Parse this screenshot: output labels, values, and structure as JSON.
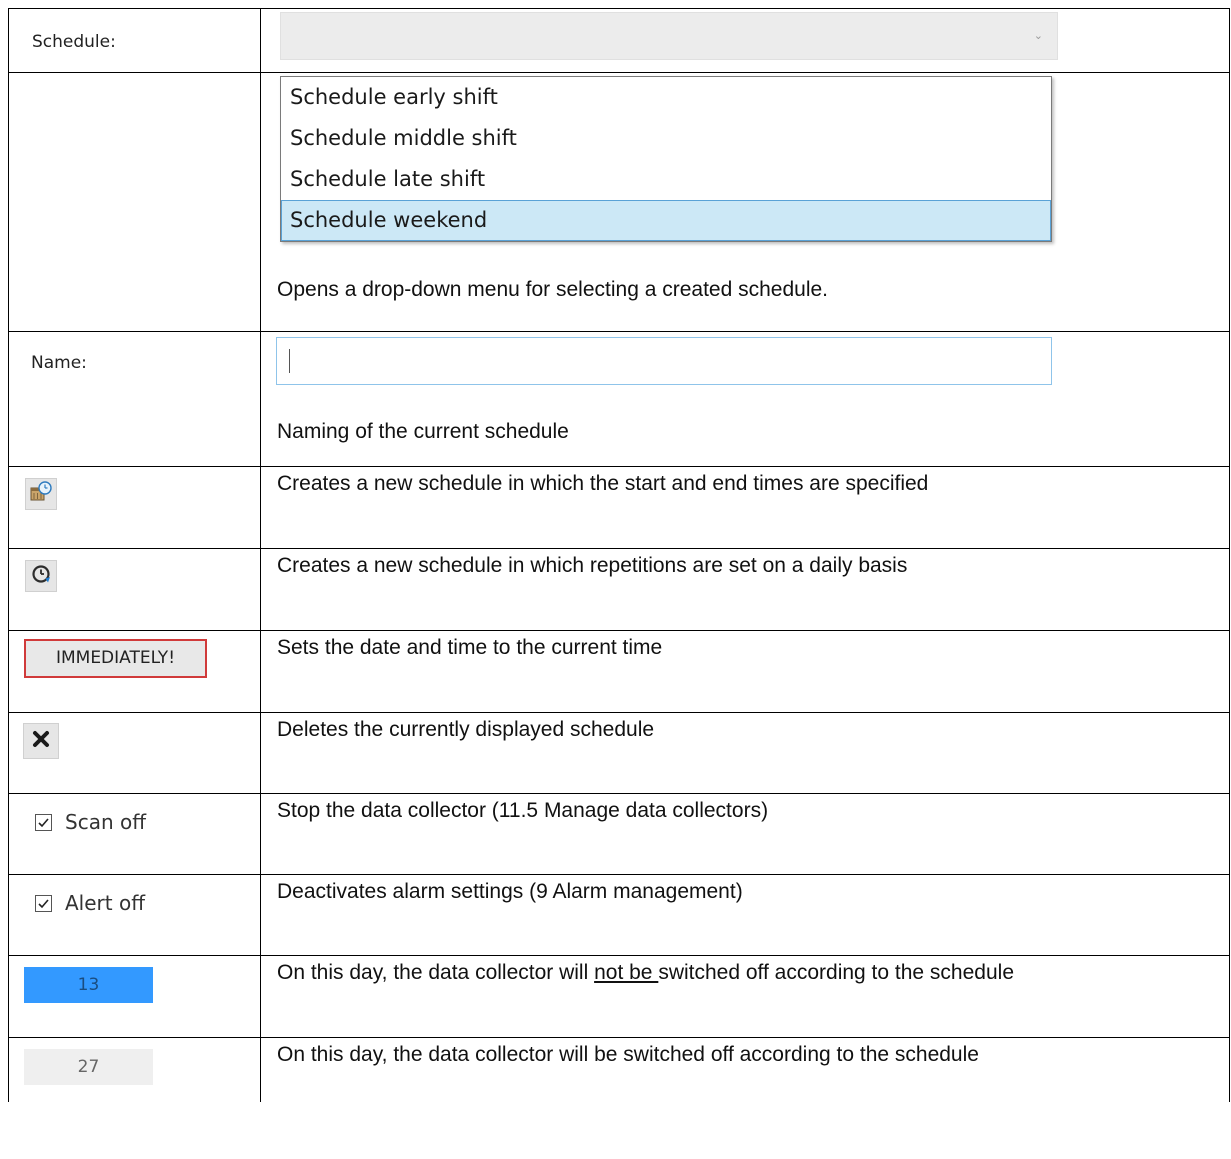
{
  "schedule_row": {
    "label": "Schedule:",
    "combo_value": ""
  },
  "dropdown_row": {
    "options": [
      "Schedule early shift",
      "Schedule middle shift",
      "Schedule late shift",
      "Schedule weekend"
    ],
    "selected_index": 3,
    "description": "Opens a drop-down menu for selecting a created schedule."
  },
  "name_row": {
    "label": "Name:",
    "input_value": "",
    "description": "Naming of the current schedule"
  },
  "new_time_schedule_row": {
    "icon": "calendar-clock-icon",
    "description": "Creates a new schedule in which the start and end times are specified"
  },
  "new_repeat_schedule_row": {
    "icon": "repeat-clock-icon",
    "description": "Creates a new schedule in which repetitions are set on a daily basis"
  },
  "immediately_row": {
    "button_label": "IMMEDIATELY!",
    "description": "Sets the date and time to the current time"
  },
  "delete_row": {
    "icon": "close-icon",
    "description": "Deletes the currently displayed schedule"
  },
  "scan_off_row": {
    "checkbox_label": "Scan off",
    "checked": true,
    "description": "Stop the data collector (11.5 Manage data collectors)"
  },
  "alert_off_row": {
    "checkbox_label": "Alert off",
    "checked": true,
    "description": "Deactivates alarm settings (9 Alarm management)"
  },
  "day_13_row": {
    "day": "13",
    "day_color": "#3399ff",
    "description_before": "On this day, the data collector will ",
    "description_underlined": "not be ",
    "description_after": "switched off according to the schedule"
  },
  "day_27_row": {
    "day": "27",
    "day_color": "#efefef",
    "description": "On this day, the data collector will be switched off according to the schedule"
  }
}
